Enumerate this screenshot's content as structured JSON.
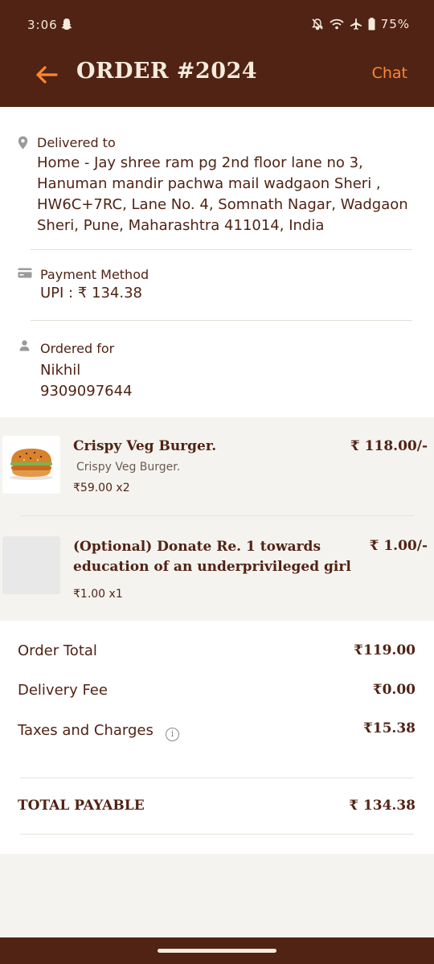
{
  "status_bar": {
    "time": "3:06",
    "battery": "75%"
  },
  "header": {
    "title": "ORDER #2024",
    "chat_label": "Chat"
  },
  "delivery": {
    "label": "Delivered to",
    "address_lines": [
      "Home - Jay shree ram pg 2nd floor lane no 3,",
      "Hanuman mandir pachwa mail wadgaon Sheri ,",
      "HW6C+7RC, Lane No. 4, Somnath Nagar, Wadgaon",
      "Sheri, Pune, Maharashtra 411014, India"
    ]
  },
  "payment": {
    "label": "Payment Method",
    "value": "UPI : ₹ 134.38"
  },
  "ordered_for": {
    "label": "Ordered for",
    "name": "Nikhil",
    "phone": "9309097644"
  },
  "items": [
    {
      "name_lines": [
        "Crispy Veg Burger."
      ],
      "description": "Crispy Veg Burger.",
      "price": "₹ 118.00/-",
      "quantity": "₹59.00 x2"
    },
    {
      "name_lines": [
        "(Optional) Donate Re. 1 towards",
        "education of an underprivileged girl"
      ],
      "description": "",
      "price": "₹ 1.00/-",
      "quantity": "₹1.00 x1"
    }
  ],
  "totals": {
    "order_total_label": "Order Total",
    "order_total_value": "₹119.00",
    "delivery_fee_label": "Delivery Fee",
    "delivery_fee_value": "₹0.00",
    "taxes_label": "Taxes and Charges",
    "taxes_value": "₹15.38",
    "payable_label": "TOTAL PAYABLE",
    "payable_value": "₹ 134.38"
  },
  "colors": {
    "brand_brown": "#502314",
    "accent_orange": "#ff8732",
    "cream": "#f5ebdc"
  }
}
